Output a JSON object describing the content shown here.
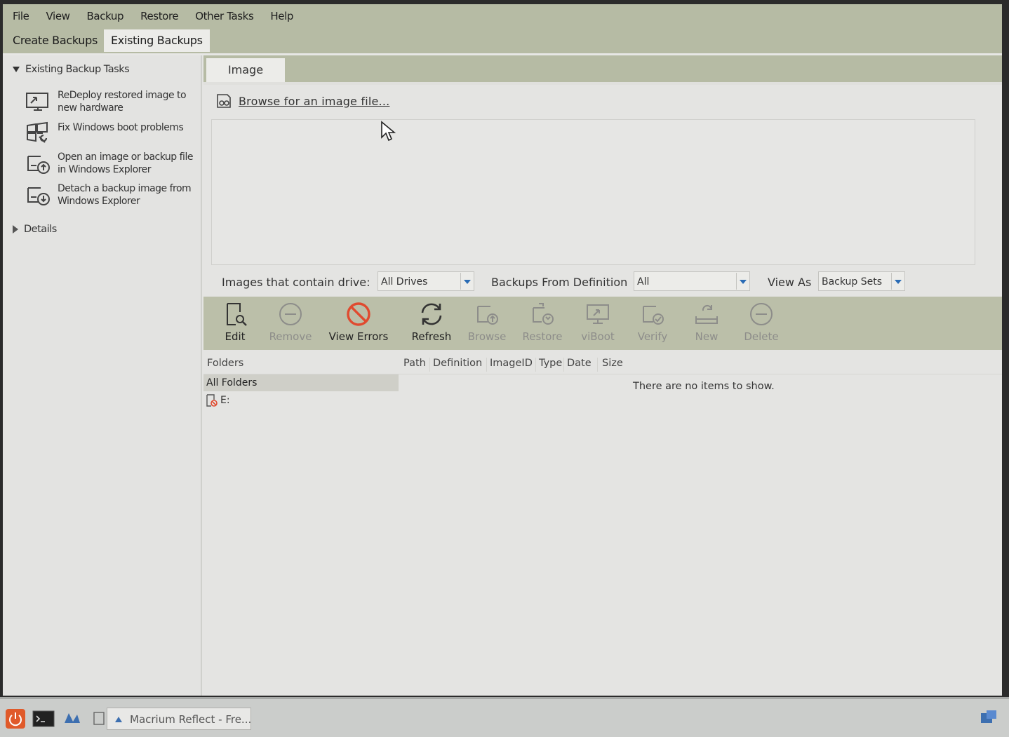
{
  "menu": [
    "File",
    "View",
    "Backup",
    "Restore",
    "Other Tasks",
    "Help"
  ],
  "main_tabs": {
    "create": "Create Backups",
    "existing": "Existing Backups"
  },
  "left_pane": {
    "tasks_header": "Existing Backup Tasks",
    "tasks": [
      {
        "icon": "monitor-redeploy-icon",
        "label": "ReDeploy restored image to new hardware"
      },
      {
        "icon": "windows-repair-icon",
        "label": "Fix Windows boot problems"
      },
      {
        "icon": "disk-open-icon",
        "label": "Open an image or backup file in Windows Explorer"
      },
      {
        "icon": "disk-detach-icon",
        "label": "Detach a backup image from Windows Explorer"
      }
    ],
    "details_header": "Details"
  },
  "right_pane": {
    "tab": "Image",
    "browse_link": "Browse for an image file...",
    "filters": {
      "drive_label": "Images that contain drive:",
      "drive_value": "All Drives",
      "definition_label": "Backups From Definition",
      "definition_value": "All",
      "viewas_label": "View As",
      "viewas_value": "Backup Sets"
    },
    "toolbar": [
      {
        "label": "Edit",
        "icon": "edit-icon",
        "enabled": true
      },
      {
        "label": "Remove",
        "icon": "remove-icon",
        "enabled": false
      },
      {
        "label": "View Errors",
        "icon": "view-errors-icon",
        "enabled": true
      },
      {
        "label": "Refresh",
        "icon": "refresh-icon",
        "enabled": true
      },
      {
        "label": "Browse",
        "icon": "browse-icon",
        "enabled": false
      },
      {
        "label": "Restore",
        "icon": "restore-icon",
        "enabled": false
      },
      {
        "label": "viBoot",
        "icon": "viboot-icon",
        "enabled": false
      },
      {
        "label": "Verify",
        "icon": "verify-icon",
        "enabled": false
      },
      {
        "label": "New",
        "icon": "new-icon",
        "enabled": false
      },
      {
        "label": "Delete",
        "icon": "delete-icon",
        "enabled": false
      }
    ],
    "list_columns": {
      "folders": "Folders",
      "path": "Path",
      "definition": "Definition",
      "imageid": "ImageID",
      "type": "Type",
      "date": "Date",
      "size": "Size"
    },
    "folders": {
      "all": "All Folders",
      "drive": "E:"
    },
    "empty_message": "There are no items to show."
  },
  "taskbar": {
    "app": "Macrium Reflect - Fre..."
  },
  "colors": {
    "chrome": "#b6bba4",
    "error_red": "#e04a2f",
    "accent_blue": "#2b6cb5"
  }
}
